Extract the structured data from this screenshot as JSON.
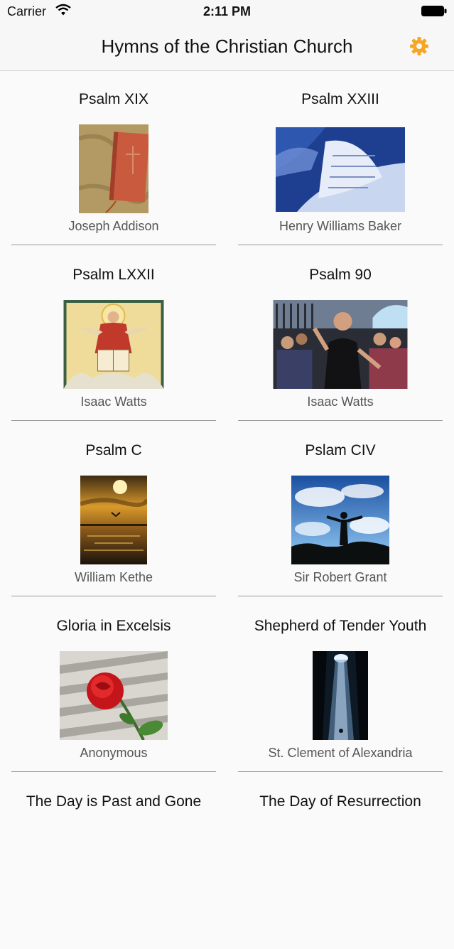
{
  "status_bar": {
    "carrier": "Carrier",
    "time": "2:11 PM"
  },
  "navbar": {
    "title": "Hymns of the Christian Church",
    "settings_icon": "gear-icon",
    "accent": "#f5a623"
  },
  "hymns": [
    {
      "title": "Psalm XIX",
      "author": "Joseph Addison",
      "image": "red-bible-icon"
    },
    {
      "title": "Psalm XXIII",
      "author": "Henry Williams Baker",
      "image": "open-book-photo"
    },
    {
      "title": "Psalm LXXII",
      "author": "Isaac Watts",
      "image": "christ-enthroned-painting"
    },
    {
      "title": "Psalm 90",
      "author": "Isaac Watts",
      "image": "worship-crowd-photo"
    },
    {
      "title": "Psalm C",
      "author": "William Kethe",
      "image": "sunset-sea-photo"
    },
    {
      "title": "Pslam CIV",
      "author": "Sir Robert Grant",
      "image": "man-under-sky-photo"
    },
    {
      "title": "Gloria in Excelsis",
      "author": "Anonymous",
      "image": "red-rose-photo"
    },
    {
      "title": "Shepherd of Tender Youth",
      "author": "St. Clement of Alexandria",
      "image": "light-beam-cave-photo"
    },
    {
      "title": "The Day is Past and Gone",
      "author": "",
      "image": ""
    },
    {
      "title": "The Day of Resurrection",
      "author": "",
      "image": ""
    }
  ]
}
